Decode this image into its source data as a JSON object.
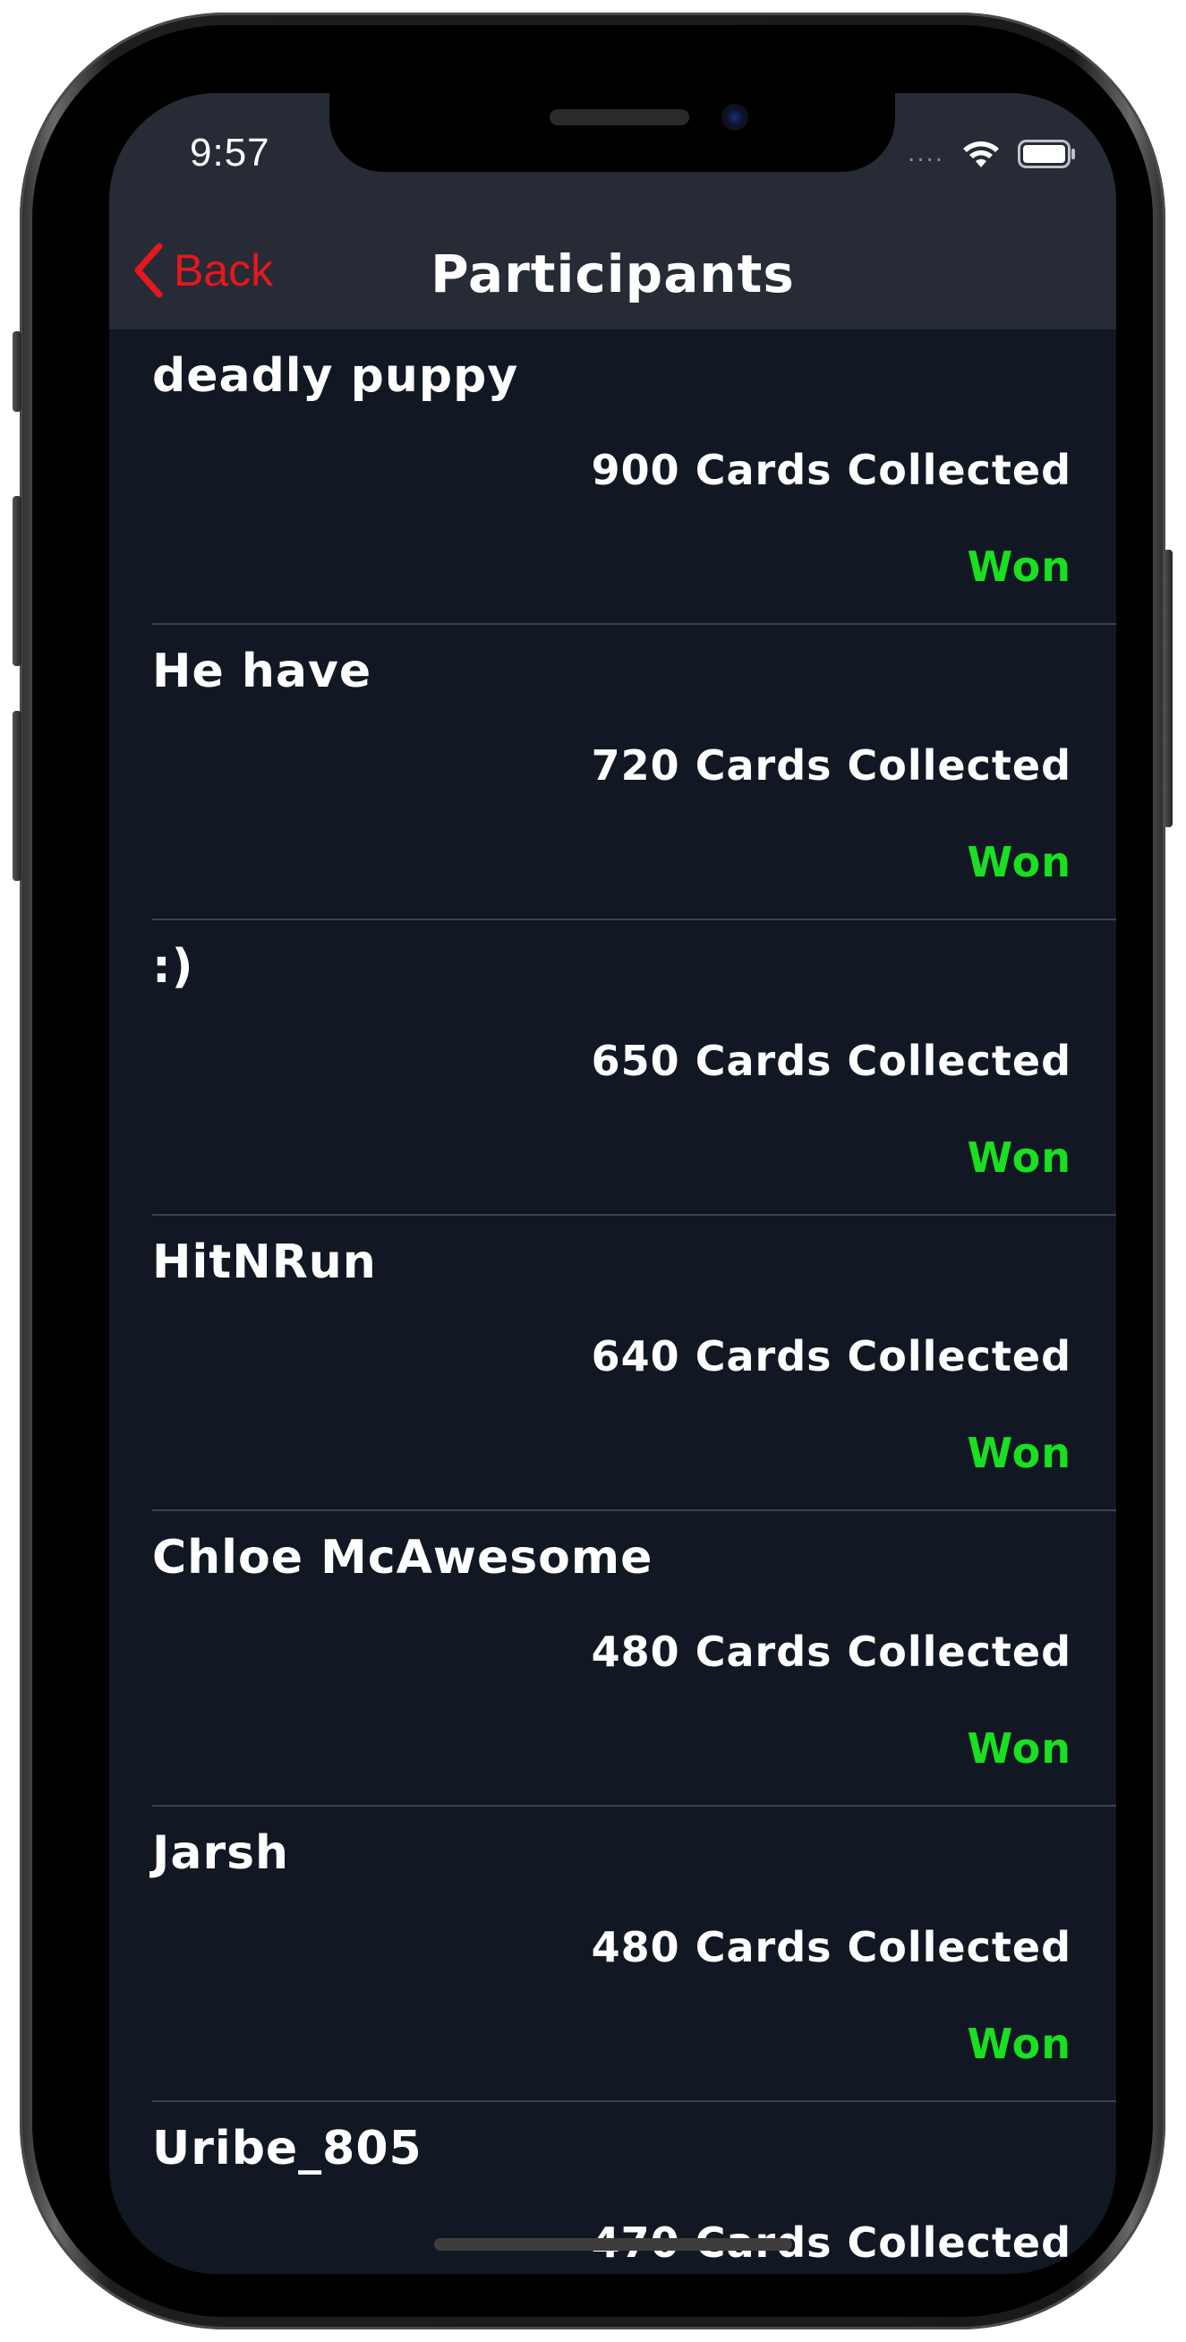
{
  "status_bar": {
    "time": "9:57",
    "signal": "....",
    "wifi_icon": "wifi-icon",
    "battery_icon": "battery-icon"
  },
  "nav": {
    "back_label": "Back",
    "back_icon": "chevron-left-icon",
    "title": "Participants"
  },
  "colors": {
    "accent": "#e4181d",
    "won": "#19e021",
    "background": "#111824",
    "bar": "#272b36"
  },
  "participants": [
    {
      "name": "deadly puppy",
      "cards": "900 Cards Collected",
      "status": "Won"
    },
    {
      "name": "He have",
      "cards": "720 Cards Collected",
      "status": "Won"
    },
    {
      "name": ":)",
      "cards": "650 Cards Collected",
      "status": "Won"
    },
    {
      "name": "HitNRun",
      "cards": "640 Cards Collected",
      "status": "Won"
    },
    {
      "name": "Chloe McAwesome",
      "cards": "480 Cards Collected",
      "status": "Won"
    },
    {
      "name": "Jarsh",
      "cards": "480 Cards Collected",
      "status": "Won"
    },
    {
      "name": "Uribe_805",
      "cards": "470 Cards Collected",
      "status": ""
    }
  ]
}
